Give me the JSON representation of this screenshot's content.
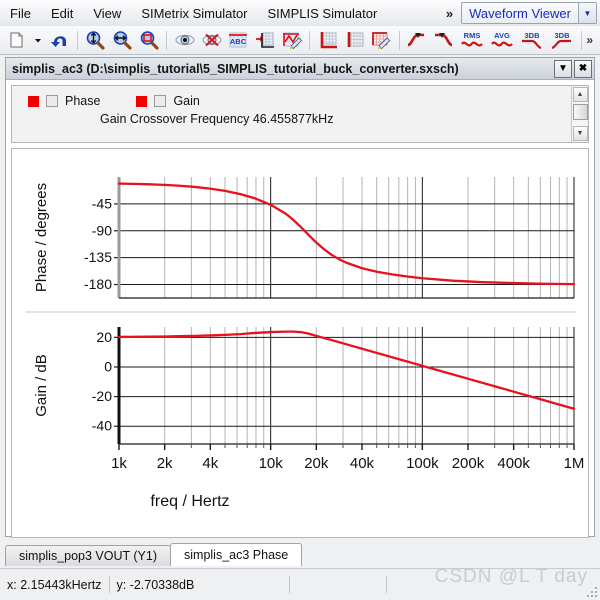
{
  "menubar": {
    "items": [
      "File",
      "Edit",
      "View",
      "SIMetrix Simulator",
      "SIMPLIS Simulator"
    ],
    "overflow": "»",
    "viewer_label": "Waveform Viewer",
    "viewer_arrow": "▼"
  },
  "toolbar": {
    "overflow": "»",
    "buttons": [
      {
        "name": "new-document-icon",
        "title": "New"
      },
      {
        "name": "new-document-dropdown-icon",
        "title": "New menu"
      },
      {
        "name": "undo-icon",
        "title": "Undo"
      },
      {
        "name": "zoom-vertical-icon",
        "title": "Zoom vertical"
      },
      {
        "name": "zoom-horizontal-icon",
        "title": "Zoom horizontal"
      },
      {
        "name": "zoom-box-icon",
        "title": "Zoom box"
      },
      {
        "name": "show-cursor-icon",
        "title": "Show cursors"
      },
      {
        "name": "hide-cursor-icon",
        "title": "Hide cursors"
      },
      {
        "name": "add-text-icon",
        "title": "Add text"
      },
      {
        "name": "add-grid-icon",
        "title": "Add grid"
      },
      {
        "name": "edit-curve-icon",
        "title": "Edit curve"
      },
      {
        "name": "axis-style-icon",
        "title": "Axis style"
      },
      {
        "name": "grid-style-icon",
        "title": "Grid style"
      },
      {
        "name": "graph-properties-icon",
        "title": "Graph properties"
      },
      {
        "name": "rise-time-icon",
        "title": "Rise time"
      },
      {
        "name": "fall-time-icon",
        "title": "Fall time"
      },
      {
        "name": "rms-icon",
        "title": "RMS",
        "text": "RMS"
      },
      {
        "name": "avg-icon",
        "title": "AVG",
        "text": "AVG"
      },
      {
        "name": "3db-lowpass-icon",
        "title": "3dB low pass",
        "text": "3DB"
      },
      {
        "name": "3db-highpass-icon",
        "title": "3dB high pass",
        "text": "3DB"
      }
    ]
  },
  "window": {
    "title": "simplis_ac3 (D:\\simplis_tutorial\\5_SIMPLIS_tutorial_buck_converter.sxsch)",
    "restore_glyph": "▼",
    "close_glyph": "✖"
  },
  "legend": {
    "entries": [
      {
        "label": "Phase",
        "color": "#f20000"
      },
      {
        "label": "Gain",
        "color": "#f20000"
      }
    ],
    "note": "Gain Crossover Frequency  46.455877kHz",
    "scroll_up": "▲",
    "scroll_down": "▼"
  },
  "tabs": [
    {
      "label": "simplis_pop3 VOUT (Y1)",
      "active": false
    },
    {
      "label": "simplis_ac3 Phase",
      "active": true
    }
  ],
  "statusbar": {
    "x_readout": "x: 2.15443kHertz",
    "y_readout": "y: -2.70338dB",
    "cell3": "",
    "cell4": ""
  },
  "watermark": "CSDN @L T day",
  "chart_data": [
    {
      "type": "line",
      "id": "phase-plot",
      "title": "",
      "xlabel": "",
      "ylabel": "Phase / degrees",
      "xscale": "log",
      "xlim": [
        1000,
        1000000
      ],
      "ylim": [
        -202.5,
        0
      ],
      "yticks": [
        -45,
        -90,
        -135,
        -180
      ],
      "ytick_labels": [
        "-45",
        "-90",
        "-135",
        "-180"
      ],
      "xticks": [
        1000,
        2000,
        4000,
        10000,
        20000,
        40000,
        100000,
        200000,
        400000,
        1000000
      ],
      "xtick_labels": [
        "1k",
        "2k",
        "4k",
        "10k",
        "20k",
        "40k",
        "100k",
        "200k",
        "400k",
        "1M"
      ],
      "grid": true,
      "series": [
        {
          "name": "Phase",
          "color": "#e8111c",
          "x": [
            1000,
            1259,
            1585,
            1995,
            2512,
            3162,
            3981,
            5012,
            6310,
            7943,
            10000,
            12589,
            14125,
            15849,
            17783,
            19953,
            22387,
            25119,
            28184,
            31623,
            39811,
            50119,
            63096,
            79433,
            100000,
            158489,
            251189,
            398107,
            630957,
            1000000
          ],
          "y": [
            -11.0,
            -11.5,
            -12.2,
            -13.2,
            -14.6,
            -16.6,
            -19.4,
            -23.2,
            -28.6,
            -36.0,
            -46.5,
            -61.5,
            -72.0,
            -84.0,
            -97.0,
            -109.5,
            -120.5,
            -130.0,
            -137.5,
            -143.5,
            -152.5,
            -158.5,
            -163.0,
            -166.5,
            -169.5,
            -173.5,
            -176.0,
            -177.5,
            -178.6,
            -179.3
          ]
        }
      ]
    },
    {
      "type": "line",
      "id": "gain-plot",
      "title": "",
      "xlabel": "freq / Hertz",
      "ylabel": "Gain / dB",
      "xscale": "log",
      "xlim": [
        1000,
        1000000
      ],
      "ylim": [
        -52,
        27
      ],
      "yticks": [
        20,
        0,
        -20,
        -40
      ],
      "ytick_labels": [
        "20",
        "0",
        "-20",
        "-40"
      ],
      "xticks": [
        1000,
        2000,
        4000,
        10000,
        20000,
        40000,
        100000,
        200000,
        400000,
        1000000
      ],
      "xtick_labels": [
        "1k",
        "2k",
        "4k",
        "10k",
        "20k",
        "40k",
        "100k",
        "200k",
        "400k",
        "1M"
      ],
      "grid": true,
      "series": [
        {
          "name": "Gain",
          "color": "#e8111c",
          "x": [
            1000,
            1259,
            1585,
            1995,
            2512,
            3162,
            3981,
            5012,
            6310,
            7943,
            10000,
            12589,
            14125,
            15849,
            17783,
            19953,
            25119,
            31623,
            39811,
            50119,
            63096,
            79433,
            100000,
            125893,
            158489,
            199526,
            251189,
            316228,
            398107,
            501187,
            630957,
            794328,
            1000000
          ],
          "y": [
            20.3,
            20.4,
            20.5,
            20.6,
            20.8,
            21.0,
            21.3,
            21.7,
            22.2,
            23.0,
            23.6,
            23.9,
            23.9,
            23.5,
            22.5,
            21.0,
            18.2,
            15.3,
            12.4,
            9.5,
            6.6,
            3.7,
            0.8,
            -2.1,
            -5.0,
            -7.9,
            -10.8,
            -13.7,
            -16.6,
            -19.5,
            -22.4,
            -25.3,
            -28.2
          ]
        }
      ]
    }
  ]
}
